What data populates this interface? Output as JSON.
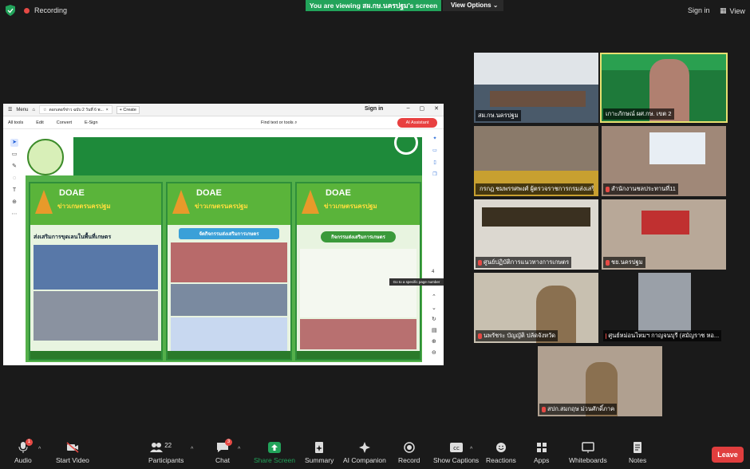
{
  "topbar": {
    "recording": "Recording",
    "viewing_text": "You are viewing สผ.กษ.นครปฐม's screen",
    "view_options": "View Options",
    "sign_in": "Sign in",
    "view": "View"
  },
  "shared_app": {
    "menu": "Menu",
    "tab_title": "ดอกเตอร์ข่าว ฉบับ 2 วันที่ 6 พ...",
    "create": "Create",
    "sign_in": "Sign in",
    "toolbar": [
      "All tools",
      "Edit",
      "Convert",
      "E-Sign"
    ],
    "find": "Find text or tools",
    "ai_assistant": "AI Assistant",
    "tooltip": "Go to a specific page number",
    "page_number": "4",
    "doc": {
      "brand": "DOAE",
      "newsletter": "ข่าวเกษตรนครปฐม",
      "panel1_heading": "ส่งเสริมการขุดเลนในพื้นที่เกษตร",
      "panel2_heading": "จัดกิจกรรมส่งเสริมการเกษตร",
      "panel3_heading": "กิจกรรมส่งเสริมการเกษตร"
    }
  },
  "participants": [
    {
      "name": "สผ.กษ.นครปฐม",
      "muted": false
    },
    {
      "name": "เกาะภักษณ์ ผศ.กษ. เขต 2",
      "muted": false
    },
    {
      "name": "กรกฎ ชมพรรศพงศ์ ผู้ตรวจราชการกรมส่งเสริม",
      "muted": true
    },
    {
      "name": "สำนักงานชลประทานที่11",
      "muted": true
    },
    {
      "name": "ศูนย์ปฏิบัติการแนวทางการเกษตร",
      "muted": true
    },
    {
      "name": "ชย.นครปฐม",
      "muted": true
    },
    {
      "name": "นพรัชระ บัญญัติ ปลัดจังหวัด",
      "muted": true
    },
    {
      "name": "ศูนย์หม่อนไหมฯ กาญจนบุรี (สมัญราช หอ...",
      "muted": true
    },
    {
      "name": "สปก.สมกฤษ ม่วนศักดิ์ภาค",
      "muted": true
    }
  ],
  "bottombar": {
    "audio": "Audio",
    "start_video": "Start Video",
    "participants": "Participants",
    "participants_count": "22",
    "chat": "Chat",
    "chat_badge": "3",
    "share_screen": "Share Screen",
    "summary": "Summary",
    "ai_companion": "AI Companion",
    "record": "Record",
    "show_captions": "Show Captions",
    "reactions": "Reactions",
    "apps": "Apps",
    "whiteboards": "Whiteboards",
    "notes": "Notes",
    "leave": "Leave",
    "audio_badge": "1"
  },
  "colors": {
    "accent_green": "#22a35a",
    "leave_red": "#e03e3e",
    "speaker_highlight": "#e8e070"
  }
}
